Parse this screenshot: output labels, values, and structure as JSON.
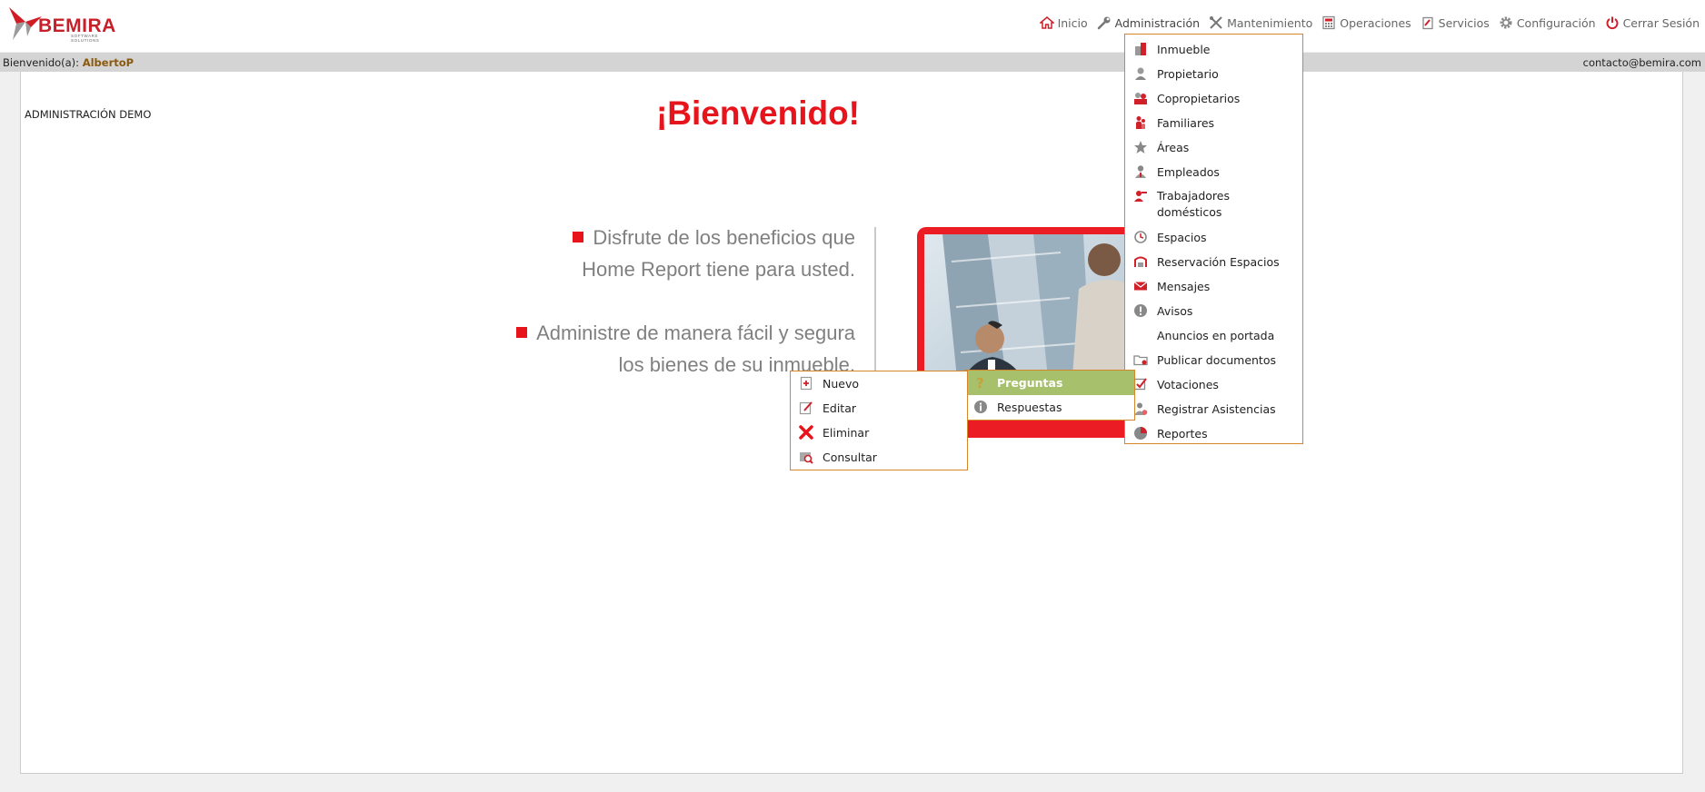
{
  "brand": {
    "name": "BEMIRA",
    "tagline": "SOFTWARE SOLUTIONS"
  },
  "nav": [
    {
      "label": "Inicio",
      "icon": "home-icon"
    },
    {
      "label": "Administración",
      "icon": "wrench-icon"
    },
    {
      "label": "Mantenimiento",
      "icon": "tools-icon"
    },
    {
      "label": "Operaciones",
      "icon": "calculator-icon"
    },
    {
      "label": "Servicios",
      "icon": "clipboard-icon"
    },
    {
      "label": "Configuración",
      "icon": "gear-icon"
    },
    {
      "label": "Cerrar Sesión",
      "icon": "power-icon"
    }
  ],
  "welcome": {
    "prefix": "Bienvenido(a):",
    "user": "AlbertoP",
    "email": "contacto@bemira.com"
  },
  "page": {
    "section_title": "ADMINISTRACIÓN DEMO",
    "hero_title": "¡Bienvenido!",
    "benefit_1_line_1": "Disfrute de los beneficios que",
    "benefit_1_line_2": "Home Report tiene para usted.",
    "benefit_2_line_1": "Administre de manera fácil y segura",
    "benefit_2_line_2": "los bienes de su inmueble."
  },
  "admin_menu": [
    {
      "label": "Inmueble",
      "icon": "building-icon"
    },
    {
      "label": "Propietario",
      "icon": "owner-icon"
    },
    {
      "label": "Copropietarios",
      "icon": "co-owners-icon"
    },
    {
      "label": "Familiares",
      "icon": "family-icon"
    },
    {
      "label": "Áreas",
      "icon": "star-icon"
    },
    {
      "label": "Empleados",
      "icon": "employee-icon"
    },
    {
      "label": "Trabajadores domésticos",
      "icon": "domestic-worker-icon"
    },
    {
      "label": "Espacios",
      "icon": "clock-icon"
    },
    {
      "label": "Reservación Espacios",
      "icon": "reservation-icon"
    },
    {
      "label": "Mensajes",
      "icon": "envelope-icon"
    },
    {
      "label": "Avisos",
      "icon": "alert-icon"
    },
    {
      "label": "Anuncios en portada",
      "icon": ""
    },
    {
      "label": "Publicar documentos",
      "icon": "folder-icon"
    },
    {
      "label": "Votaciones",
      "icon": "checkbox-icon"
    },
    {
      "label": "Registrar Asistencias",
      "icon": "attendance-icon"
    },
    {
      "label": "Reportes",
      "icon": "pie-chart-icon"
    }
  ],
  "votaciones_submenu": [
    {
      "label": "Preguntas",
      "icon": "question-icon"
    },
    {
      "label": "Respuestas",
      "icon": "info-icon"
    }
  ],
  "preguntas_submenu": [
    {
      "label": "Nuevo",
      "icon": "new-document-icon"
    },
    {
      "label": "Editar",
      "icon": "edit-icon"
    },
    {
      "label": "Eliminar",
      "icon": "delete-x-icon"
    },
    {
      "label": "Consultar",
      "icon": "search-document-icon"
    }
  ],
  "colors": {
    "brand_red": "#e8141c",
    "menu_border": "#d4862a",
    "highlight": "#a7c06c",
    "username": "#8a5a10"
  }
}
